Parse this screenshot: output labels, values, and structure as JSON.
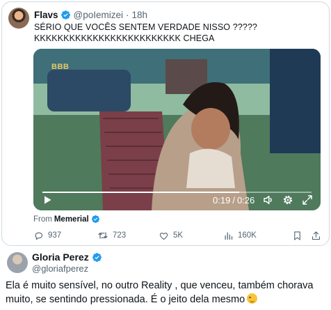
{
  "quoted_tweet": {
    "author_name": "Flavs",
    "handle": "@poIemizei",
    "separator": "·",
    "time": "18h",
    "text_line1": "SÉRIO QUE VOCÊS SENTEM VERDADE NISSO ?????",
    "text_line2": "KKKKKKKKKKKKKKKKKKKKKKKKK CHEGA",
    "video": {
      "logo": "BBB",
      "current_time": "0:19",
      "time_separator": "/",
      "duration": "0:26",
      "progress": 0.73
    },
    "from_label": "From",
    "from_source": "Memerial",
    "actions": {
      "replies": "937",
      "reposts": "723",
      "likes": "5K",
      "views": "160K"
    }
  },
  "reply_tweet": {
    "author_name": "Gloria Perez",
    "handle": "@gloriafperez",
    "text": "Ela é muito sensível, no outro Reality , que venceu, também chorava muito, se sentindo pressionada. É o jeito dela mesmo",
    "emoji": "wink-face-emoji"
  },
  "colors": {
    "verified": "#1d9bf0",
    "muted": "#536471",
    "border": "#cfd9de"
  }
}
